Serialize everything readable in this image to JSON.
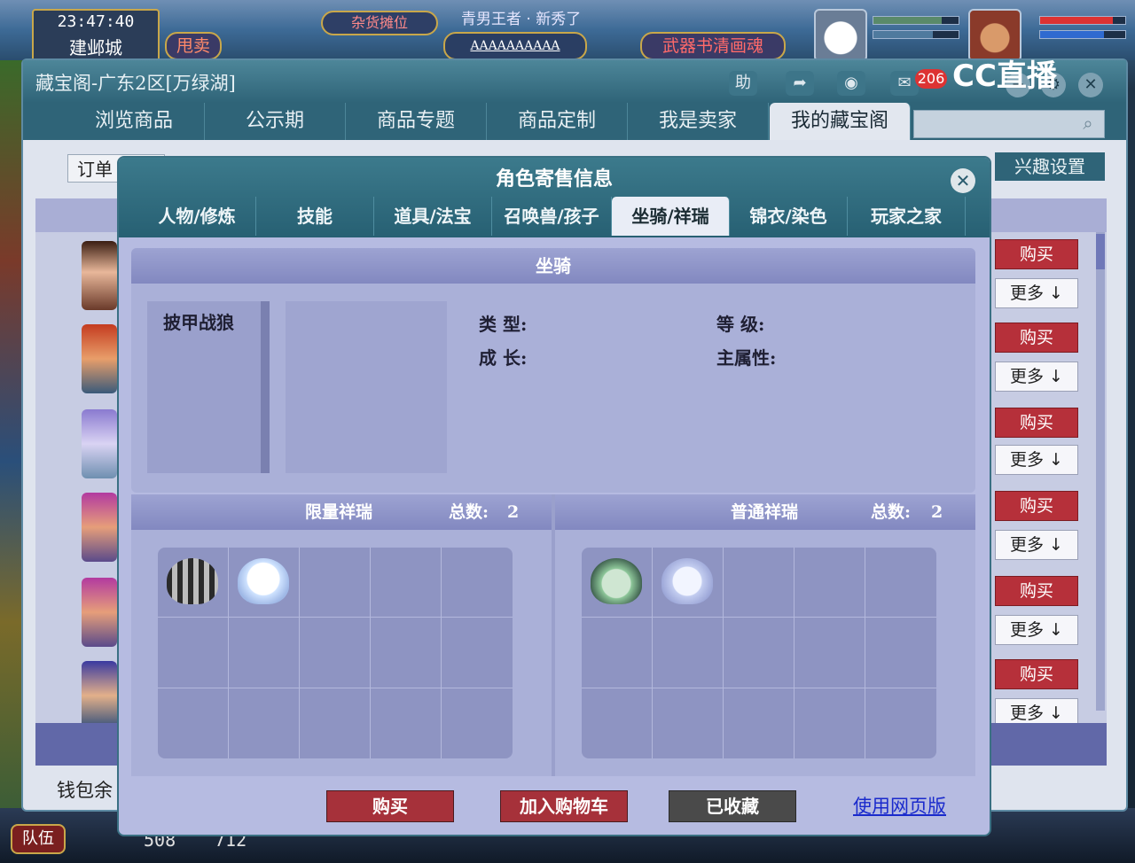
{
  "hud": {
    "time": "23:47:40",
    "city": "建邺城",
    "stall_label": "杂货摊位",
    "sell_label": "甩卖",
    "marquee": "青男王者 · 新秀了",
    "name_tag": "AAAAAAAAAA",
    "weapon_label": "武器书清画魂",
    "team_label": "队伍",
    "coord_x": "508",
    "coord_y": "712",
    "cc_brand": "CC直播"
  },
  "window": {
    "title": "藏宝阁-广东2区[万绿湖]",
    "help_label": "助",
    "message_badge": "206",
    "tabs": [
      "浏览商品",
      "公示期",
      "商品专题",
      "商品定制",
      "我是卖家",
      "我的藏宝阁"
    ],
    "active_tab_index": 5,
    "order_tab": "订单",
    "interest_button": "兴趣设置",
    "wallet_label": "钱包余",
    "buy_label": "购买",
    "more_label": "更多",
    "row_count": 6
  },
  "dialog": {
    "title": "角色寄售信息",
    "tabs": [
      "人物/修炼",
      "技能",
      "道具/法宝",
      "召唤兽/孩子",
      "坐骑/祥瑞",
      "锦衣/染色",
      "玩家之家"
    ],
    "active_tab_index": 4,
    "mount": {
      "header": "坐骑",
      "items": [
        "披甲战狼"
      ],
      "type_label": "类  型:",
      "growth_label": "成  长:",
      "level_label": "等  级:",
      "main_attr_label": "主属性:"
    },
    "limited": {
      "header": "限量祥瑞",
      "total_label": "总数:",
      "total": "2"
    },
    "normal": {
      "header": "普通祥瑞",
      "total_label": "总数:",
      "total": "2"
    },
    "buttons": {
      "buy": "购买",
      "add_cart": "加入购物车",
      "favorited": "已收藏",
      "web_version": "使用网页版"
    }
  },
  "colors": {
    "teal_header": "#2f6478",
    "buy_red": "#b6303a",
    "panel_lavender": "#aab0d8",
    "link_blue": "#1a2acc"
  }
}
